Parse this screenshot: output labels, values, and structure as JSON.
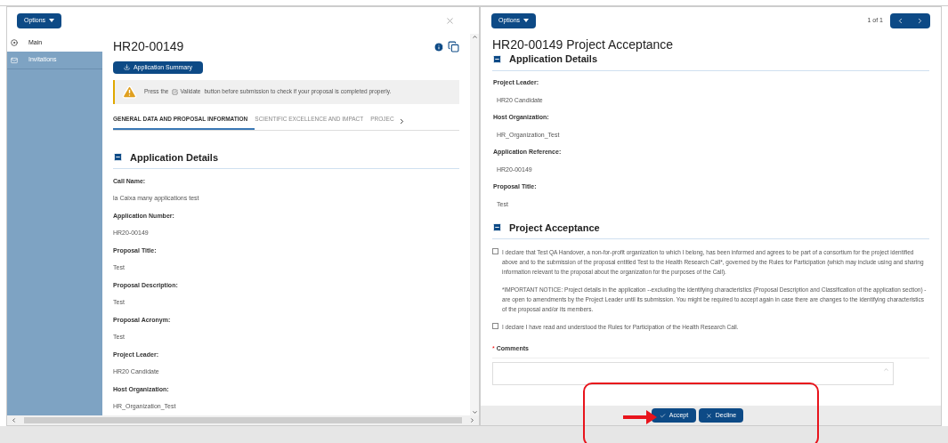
{
  "left": {
    "options_button": "Options",
    "sidebar": {
      "items": [
        {
          "label": "Main",
          "selected": true
        },
        {
          "label": "Invitations",
          "selected": false
        }
      ]
    },
    "title": "HR20-00149",
    "summary_button": "Application Summary",
    "alert": {
      "text_before": "Press the",
      "button_text": "Validate",
      "text_after": "button before submission to check if your proposal is completed properly."
    },
    "tabs": [
      {
        "label": "GENERAL DATA AND PROPOSAL INFORMATION",
        "selected": true
      },
      {
        "label": "SCIENTIFIC EXCELLENCE AND IMPACT",
        "selected": false
      },
      {
        "label": "PROJEC",
        "selected": false
      }
    ],
    "section": "Application Details",
    "fields": [
      {
        "label": "Call Name:",
        "value": "la Caixa many applications test"
      },
      {
        "label": "Application Number:",
        "value": "HR20-00149"
      },
      {
        "label": "Proposal Title:",
        "value": "Test"
      },
      {
        "label": "Proposal Description:",
        "value": "Test"
      },
      {
        "label": "Proposal Acronym:",
        "value": "Test"
      },
      {
        "label": "Project Leader:",
        "value": "HR20 Candidate"
      },
      {
        "label": "Host Organization:",
        "value": "HR_Organization_Test"
      }
    ]
  },
  "right": {
    "options_button": "Options",
    "pager": "1 of 1",
    "title": "HR20-00149 Project Acceptance",
    "section": "Application Details",
    "fields": [
      {
        "label": "Project Leader:",
        "value": "HR20 Candidate"
      },
      {
        "label": "Host Organization:",
        "value": "HR_Organization_Test"
      },
      {
        "label": "Application Reference:",
        "value": "HR20-00149"
      },
      {
        "label": "Proposal Title:",
        "value": "Test"
      }
    ],
    "acceptance_section": "Project Acceptance",
    "declarations": [
      {
        "text": "I declare that Test QA Handover, a non-for-profit organization to which I belong, has been informed and agrees to be part of a consortium for the project identified above and to the submission of the proposal entitled Test to the Health Research Call*, governed by the Rules for Participation (which may include using and sharing information relevant to the proposal about the organization for the purposes of the Call).",
        "notice": "*IMPORTANT NOTICE: Project details in the application --excluding the identifying characteristics (Proposal Description and Classification of the application section) - are open to amendments by the Project Leader until its submission. You might be required to accept again in case there are changes to the identifying characteristics of the proposal and/or its members.",
        "checked": false
      },
      {
        "text": "I declare I have read and understood the Rules for Participation of the Health Research Call.",
        "checked": false
      }
    ],
    "comments": {
      "label": "Comments",
      "required": true,
      "required_mark": "*"
    },
    "buttons": [
      {
        "label": "Accept",
        "kind": "accept"
      },
      {
        "label": "Decline",
        "kind": "decline"
      }
    ]
  }
}
